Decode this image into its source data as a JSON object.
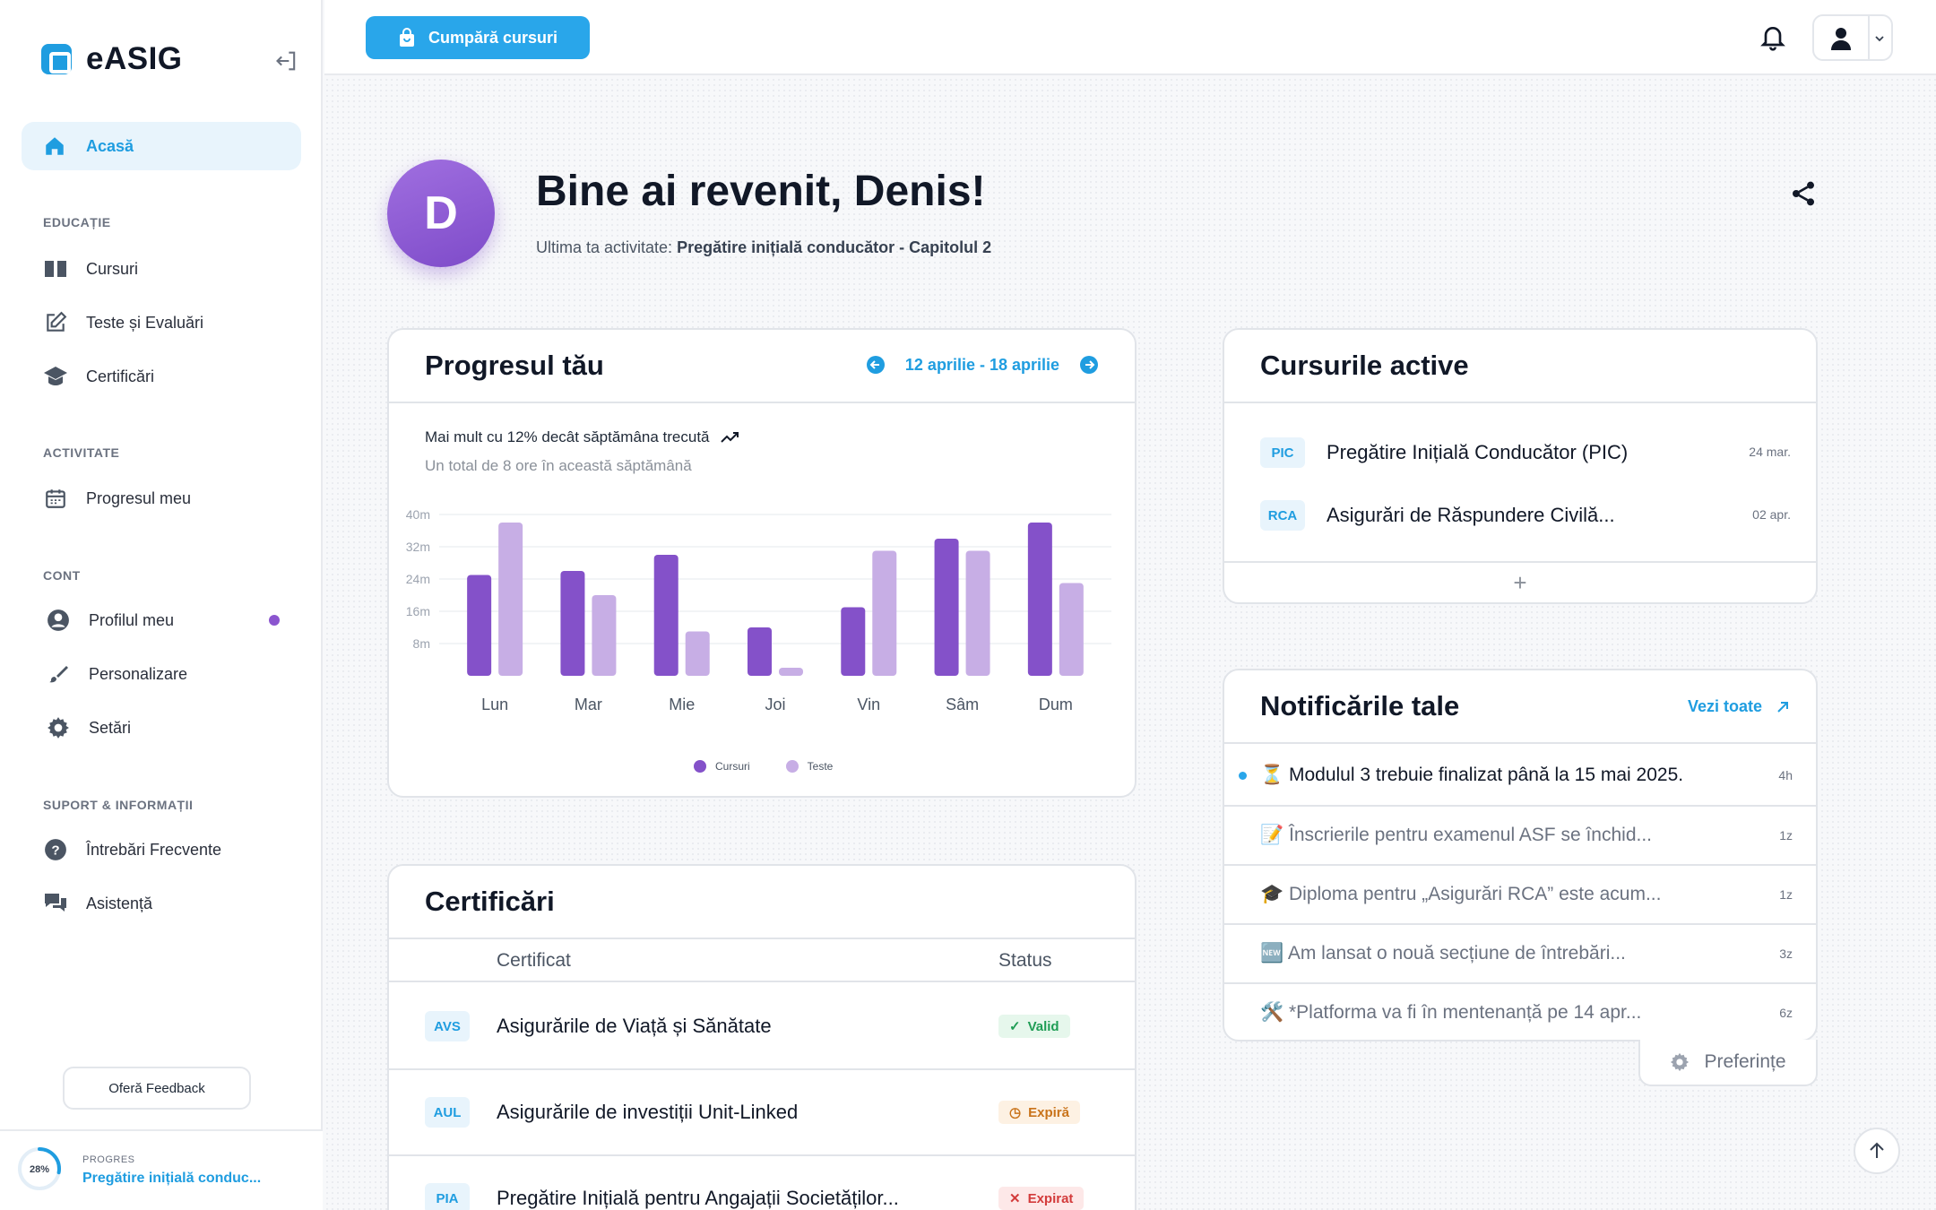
{
  "app": {
    "name": "eASIG"
  },
  "sidebar": {
    "home": "Acasă",
    "sections": [
      {
        "title": "EDUCAȚIE",
        "items": [
          "Cursuri",
          "Teste și Evaluări",
          "Certificări"
        ]
      },
      {
        "title": "ACTIVITATE",
        "items": [
          "Progresul meu"
        ]
      },
      {
        "title": "CONT",
        "items": [
          "Profilul meu",
          "Personalizare",
          "Setări"
        ]
      },
      {
        "title": "SUPORT & INFORMAȚII",
        "items": [
          "Întrebări Frecvente",
          "Asistență"
        ]
      }
    ],
    "feedback": "Oferă Feedback",
    "progress": {
      "label": "PROGRES",
      "percent": "28%",
      "value": 0.28,
      "course": "Pregătire inițială conduc..."
    }
  },
  "topbar": {
    "buy_label": "Cumpără cursuri"
  },
  "welcome": {
    "initial": "D",
    "title": "Bine ai revenit, Denis!",
    "last_activity_label": "Ultima ta activitate:",
    "last_activity_value": "Pregătire inițială conducător - Capitolul 2"
  },
  "progress_card": {
    "title": "Progresul tău",
    "date_range": "12 aprilie - 18 aprilie",
    "trend": "Mai mult cu 12% decât săptămâna trecută",
    "total": "Un total de 8 ore în această săptămână",
    "legend": [
      "Cursuri",
      "Teste"
    ]
  },
  "chart_data": {
    "type": "bar",
    "categories": [
      "Lun",
      "Mar",
      "Mie",
      "Joi",
      "Vin",
      "Sâm",
      "Dum"
    ],
    "series": [
      {
        "name": "Cursuri",
        "values": [
          25,
          26,
          30,
          12,
          17,
          34,
          38
        ],
        "color": "#8451c9"
      },
      {
        "name": "Teste",
        "values": [
          38,
          20,
          11,
          2,
          31,
          31,
          23
        ],
        "color": "#c7aee5"
      }
    ],
    "yticks": [
      "8m",
      "16m",
      "24m",
      "32m",
      "40m"
    ],
    "ylim": [
      0,
      40
    ],
    "grid": true,
    "legend_position": "bottom"
  },
  "active_courses": {
    "title": "Cursurile active",
    "items": [
      {
        "tag": "PIC",
        "name": "Pregătire Inițială Conducător (PIC)",
        "date": "24 mar."
      },
      {
        "tag": "RCA",
        "name": "Asigurări de Răspundere Civilă...",
        "date": "02 apr."
      }
    ],
    "add": "+"
  },
  "notifications": {
    "title": "Notificările tale",
    "see_all": "Vezi toate",
    "items": [
      {
        "text": "⏳ Modulul 3 trebuie finalizat până la 15 mai 2025.",
        "time": "4h"
      },
      {
        "text": "📝 Înscrierile pentru examenul ASF se închid...",
        "time": "1z"
      },
      {
        "text": "🎓 Diploma pentru „Asigurări RCA” este acum...",
        "time": "1z"
      },
      {
        "text": "🆕 Am lansat o nouă secțiune de întrebări...",
        "time": "3z"
      },
      {
        "text": "🛠️ *Platforma va fi în mentenanță pe 14 apr...",
        "time": "6z"
      }
    ],
    "preferences": "Preferințe"
  },
  "certificates": {
    "title": "Certificări",
    "col_cert": "Certificat",
    "col_status": "Status",
    "rows": [
      {
        "tag": "AVS",
        "name": "Asigurările de Viață și Sănătate",
        "status": "Valid",
        "status_icon": "✓"
      },
      {
        "tag": "AUL",
        "name": "Asigurările de investiții Unit-Linked",
        "status": "Expiră",
        "status_icon": "◷"
      },
      {
        "tag": "PIA",
        "name": "Pregătire Inițială pentru Angajații Societăților...",
        "status": "Expirat",
        "status_icon": "✕"
      }
    ]
  }
}
